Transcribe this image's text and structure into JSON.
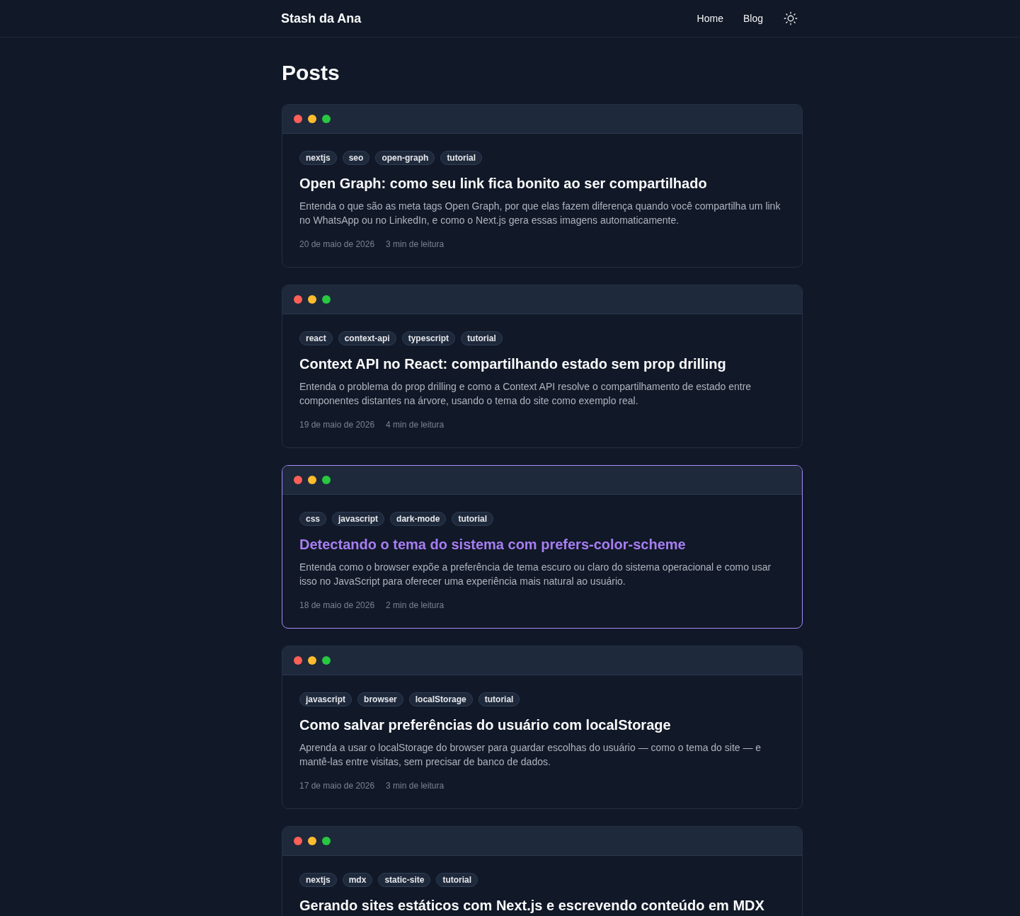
{
  "header": {
    "logo": "Stash da Ana",
    "nav": [
      {
        "label": "Home"
      },
      {
        "label": "Blog"
      }
    ]
  },
  "page_title": "Posts",
  "posts": [
    {
      "hovered": false,
      "tags": [
        "nextjs",
        "seo",
        "open-graph",
        "tutorial"
      ],
      "title": "Open Graph: como seu link fica bonito ao ser compartilhado",
      "description": "Entenda o que são as meta tags Open Graph, por que elas fazem diferença quando você compartilha um link no WhatsApp ou no LinkedIn, e como o Next.js gera essas imagens automaticamente.",
      "date": "20 de maio de 2026",
      "reading_time": "3 min de leitura"
    },
    {
      "hovered": false,
      "tags": [
        "react",
        "context-api",
        "typescript",
        "tutorial"
      ],
      "title": "Context API no React: compartilhando estado sem prop drilling",
      "description": "Entenda o problema do prop drilling e como a Context API resolve o compartilhamento de estado entre componentes distantes na árvore, usando o tema do site como exemplo real.",
      "date": "19 de maio de 2026",
      "reading_time": "4 min de leitura"
    },
    {
      "hovered": true,
      "tags": [
        "css",
        "javascript",
        "dark-mode",
        "tutorial"
      ],
      "title": "Detectando o tema do sistema com prefers-color-scheme",
      "description": "Entenda como o browser expõe a preferência de tema escuro ou claro do sistema operacional e como usar isso no JavaScript para oferecer uma experiência mais natural ao usuário.",
      "date": "18 de maio de 2026",
      "reading_time": "2 min de leitura"
    },
    {
      "hovered": false,
      "tags": [
        "javascript",
        "browser",
        "localStorage",
        "tutorial"
      ],
      "title": "Como salvar preferências do usuário com localStorage",
      "description": "Aprenda a usar o localStorage do browser para guardar escolhas do usuário — como o tema do site — e mantê-las entre visitas, sem precisar de banco de dados.",
      "date": "17 de maio de 2026",
      "reading_time": "3 min de leitura"
    },
    {
      "hovered": false,
      "tags": [
        "nextjs",
        "mdx",
        "static-site",
        "tutorial"
      ],
      "title": "Gerando sites estáticos com Next.js e escrevendo conteúdo em MDX"
    }
  ]
}
